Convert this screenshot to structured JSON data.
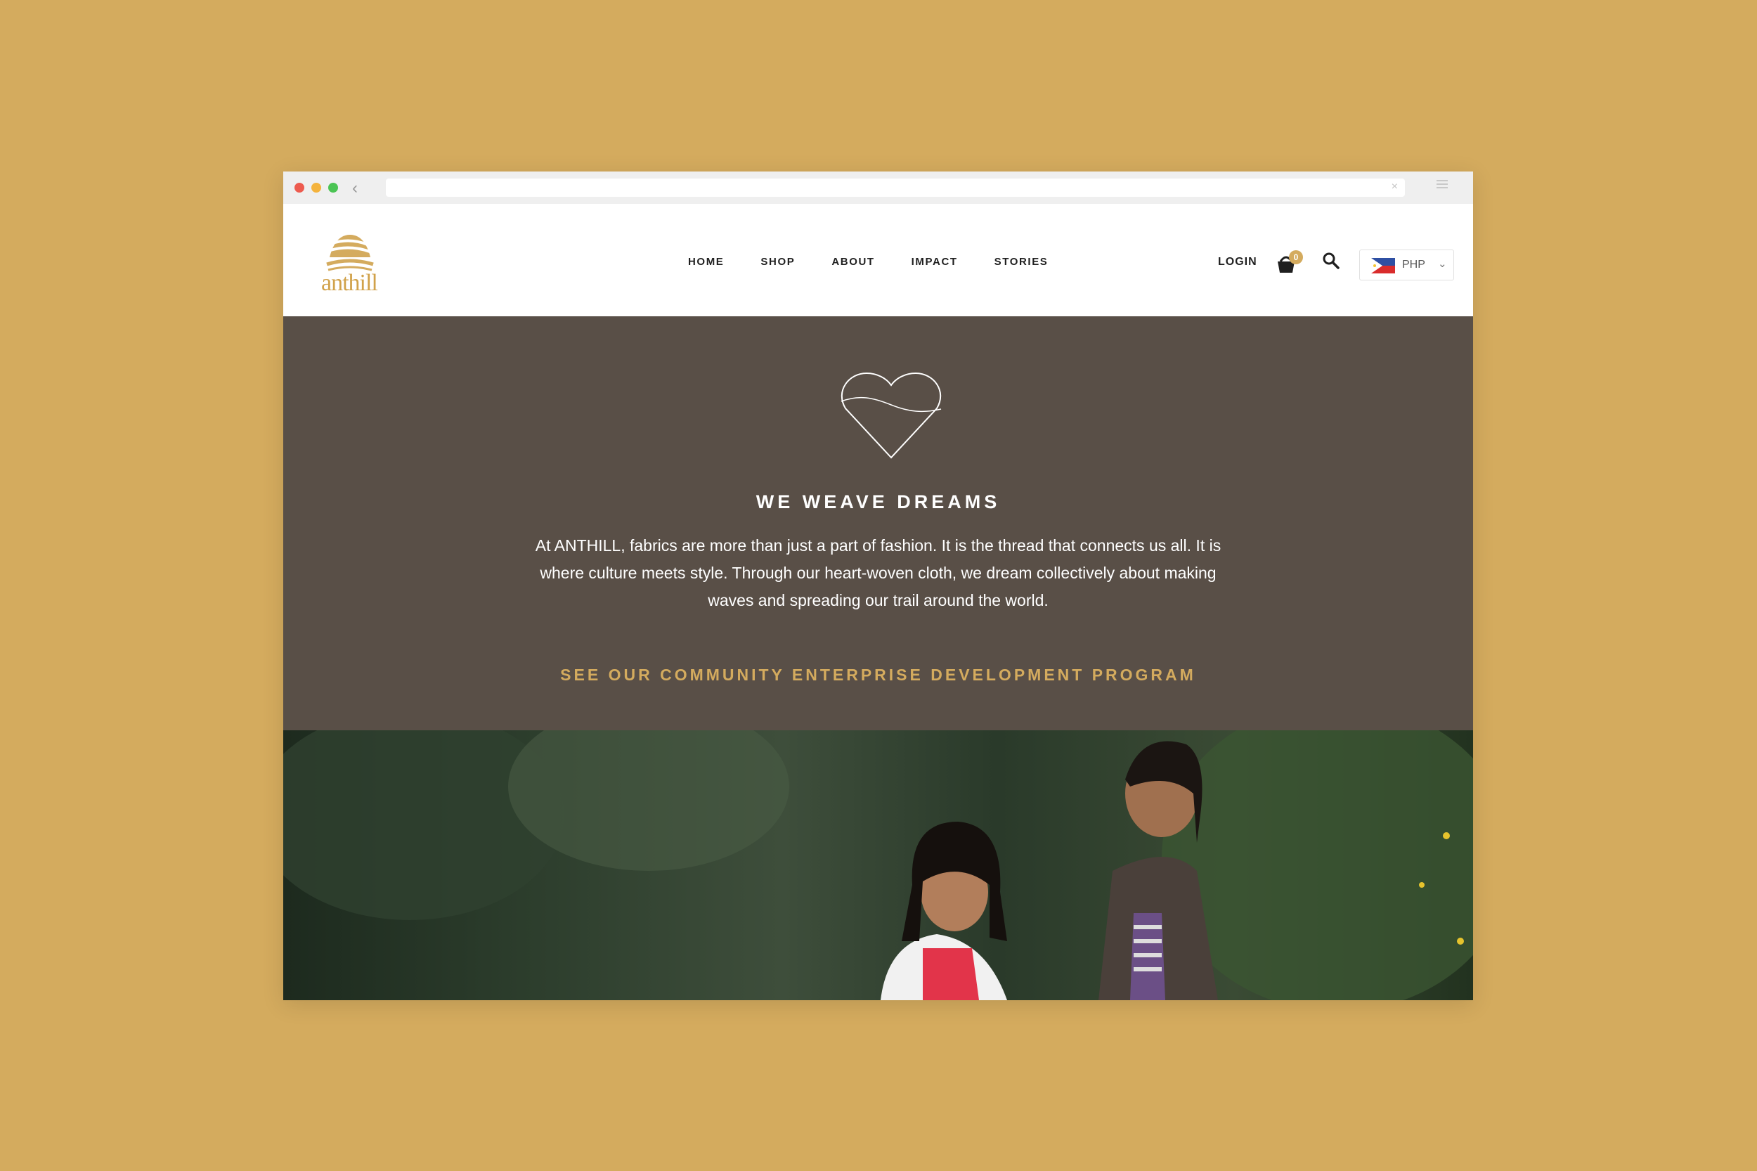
{
  "nav": {
    "items": [
      "HOME",
      "SHOP",
      "ABOUT",
      "IMPACT",
      "STORIES"
    ]
  },
  "logo": {
    "text": "anthill"
  },
  "header": {
    "login": "LOGIN",
    "cart_count": "0",
    "currency": "PHP"
  },
  "hero": {
    "title": "WE WEAVE DREAMS",
    "text": "At ANTHILL, fabrics are more than just a part of fashion. It is the thread that connects us all. It is where culture meets style. Through our heart-woven cloth, we dream collectively about making waves and spreading our trail around the world.",
    "link": "SEE OUR COMMUNITY ENTERPRISE DEVELOPMENT PROGRAM"
  },
  "colors": {
    "page_bg": "#d4ab5e",
    "hero_bg": "#594f47",
    "accent": "#d4ab5e"
  },
  "icons": [
    "back-icon",
    "menu-icon",
    "cart-icon",
    "search-icon",
    "flag-icon",
    "chevron-down-icon",
    "heart-icon"
  ]
}
